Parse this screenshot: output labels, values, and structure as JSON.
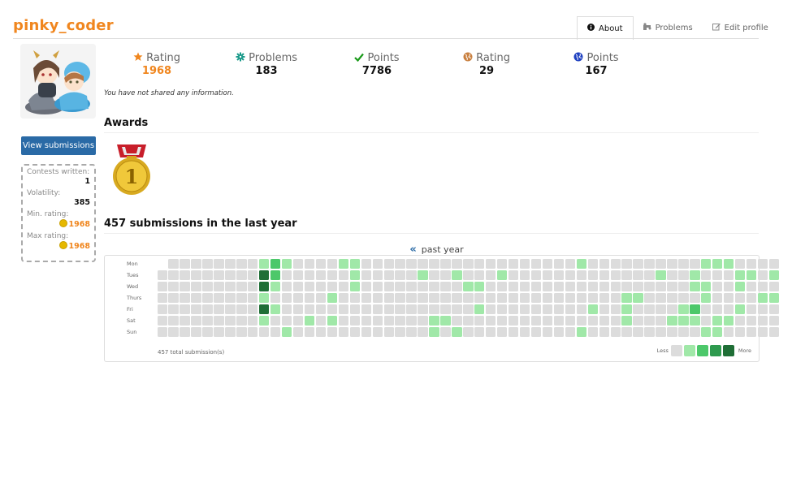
{
  "header": {
    "username": "pinky_coder",
    "tabs": [
      {
        "label": "About",
        "icon": "info-circle-icon",
        "active": true
      },
      {
        "label": "Problems",
        "icon": "puzzle-icon",
        "active": false
      },
      {
        "label": "Edit profile",
        "icon": "edit-icon",
        "active": false
      }
    ]
  },
  "sidebar": {
    "view_submissions": "View submissions",
    "contests_written_label": "Contests written:",
    "contests_written": "1",
    "volatility_label": "Volatility:",
    "volatility": "385",
    "min_rating_label": "Min. rating:",
    "min_rating": "1968",
    "max_rating_label": "Max rating:",
    "max_rating": "1968"
  },
  "stats": [
    {
      "label": "Rating",
      "value": "1968",
      "icon": "star-icon",
      "color": "#f0861e"
    },
    {
      "label": "Problems",
      "value": "183",
      "icon": "puzzle-piece-icon",
      "color": "#1a9a8a"
    },
    {
      "label": "Points",
      "value": "7786",
      "icon": "check-icon",
      "color": "#1a9a1a"
    },
    {
      "label": "Rating",
      "value": "29",
      "icon": "globe-icon",
      "color": "#c98040"
    },
    {
      "label": "Points",
      "value": "167",
      "icon": "globe-blue-icon",
      "color": "#1e40c0"
    }
  ],
  "info_text": "You have not shared any information.",
  "awards": {
    "title": "Awards",
    "medal_number": "1"
  },
  "submissions": {
    "title": "457 submissions in the last year",
    "nav_label": "past year",
    "total_label": "457 total submission(s)",
    "legend_less": "Less",
    "legend_more": "More",
    "days": [
      "Mon",
      "Tues",
      "Wed",
      "Thurs",
      "Fri",
      "Sat",
      "Sun"
    ],
    "levels_colors": [
      "#dcdcdc",
      "#a0e8a8",
      "#4cc86a",
      "#2e9a4e",
      "#1f6e36"
    ],
    "weeks": [
      [
        -1,
        0,
        0,
        0,
        0,
        0,
        0
      ],
      [
        0,
        0,
        0,
        0,
        0,
        0,
        0
      ],
      [
        0,
        0,
        0,
        0,
        0,
        0,
        0
      ],
      [
        0,
        0,
        0,
        0,
        0,
        0,
        0
      ],
      [
        0,
        0,
        0,
        0,
        0,
        0,
        0
      ],
      [
        0,
        0,
        0,
        0,
        0,
        0,
        0
      ],
      [
        0,
        0,
        0,
        0,
        0,
        0,
        0
      ],
      [
        0,
        0,
        0,
        0,
        0,
        0,
        0
      ],
      [
        0,
        0,
        0,
        0,
        0,
        0,
        0
      ],
      [
        1,
        4,
        4,
        1,
        4,
        1,
        0
      ],
      [
        2,
        2,
        1,
        0,
        1,
        0,
        0
      ],
      [
        1,
        0,
        0,
        0,
        0,
        0,
        1
      ],
      [
        0,
        0,
        0,
        0,
        0,
        0,
        0
      ],
      [
        0,
        0,
        0,
        0,
        0,
        1,
        0
      ],
      [
        0,
        0,
        0,
        0,
        0,
        0,
        0
      ],
      [
        0,
        0,
        0,
        1,
        0,
        1,
        0
      ],
      [
        1,
        0,
        0,
        0,
        0,
        0,
        0
      ],
      [
        1,
        1,
        1,
        0,
        0,
        0,
        0
      ],
      [
        0,
        0,
        0,
        0,
        0,
        0,
        0
      ],
      [
        0,
        0,
        0,
        0,
        0,
        0,
        0
      ],
      [
        0,
        0,
        0,
        0,
        0,
        0,
        0
      ],
      [
        0,
        0,
        0,
        0,
        0,
        0,
        0
      ],
      [
        0,
        0,
        0,
        0,
        0,
        0,
        0
      ],
      [
        0,
        1,
        0,
        0,
        0,
        0,
        0
      ],
      [
        0,
        0,
        0,
        0,
        0,
        1,
        1
      ],
      [
        0,
        0,
        0,
        0,
        0,
        1,
        0
      ],
      [
        0,
        1,
        0,
        0,
        0,
        0,
        1
      ],
      [
        0,
        0,
        1,
        0,
        0,
        0,
        0
      ],
      [
        0,
        0,
        1,
        0,
        1,
        0,
        0
      ],
      [
        0,
        0,
        0,
        0,
        0,
        0,
        0
      ],
      [
        0,
        1,
        0,
        0,
        0,
        0,
        0
      ],
      [
        0,
        0,
        0,
        0,
        0,
        0,
        0
      ],
      [
        0,
        0,
        0,
        0,
        0,
        0,
        0
      ],
      [
        0,
        0,
        0,
        0,
        0,
        0,
        0
      ],
      [
        0,
        0,
        0,
        0,
        0,
        0,
        0
      ],
      [
        0,
        0,
        0,
        0,
        0,
        0,
        0
      ],
      [
        0,
        0,
        0,
        0,
        0,
        0,
        0
      ],
      [
        1,
        0,
        0,
        0,
        0,
        0,
        1
      ],
      [
        0,
        0,
        0,
        0,
        1,
        0,
        0
      ],
      [
        0,
        0,
        0,
        0,
        0,
        0,
        0
      ],
      [
        0,
        0,
        0,
        0,
        0,
        0,
        0
      ],
      [
        0,
        0,
        0,
        1,
        1,
        1,
        0
      ],
      [
        0,
        0,
        0,
        1,
        0,
        0,
        0
      ],
      [
        0,
        0,
        0,
        0,
        0,
        0,
        0
      ],
      [
        0,
        1,
        0,
        0,
        0,
        0,
        0
      ],
      [
        0,
        0,
        0,
        0,
        0,
        1,
        0
      ],
      [
        0,
        0,
        0,
        0,
        1,
        1,
        0
      ],
      [
        0,
        1,
        1,
        0,
        2,
        1,
        0
      ],
      [
        1,
        0,
        1,
        1,
        0,
        0,
        1
      ],
      [
        1,
        0,
        0,
        0,
        0,
        1,
        1
      ],
      [
        1,
        0,
        0,
        0,
        0,
        1,
        0
      ],
      [
        0,
        1,
        1,
        0,
        1,
        0,
        0
      ],
      [
        0,
        1,
        0,
        0,
        0,
        0,
        0
      ],
      [
        0,
        0,
        0,
        1,
        0,
        0,
        0
      ],
      [
        0,
        1,
        0,
        1,
        0,
        0,
        0
      ]
    ]
  }
}
